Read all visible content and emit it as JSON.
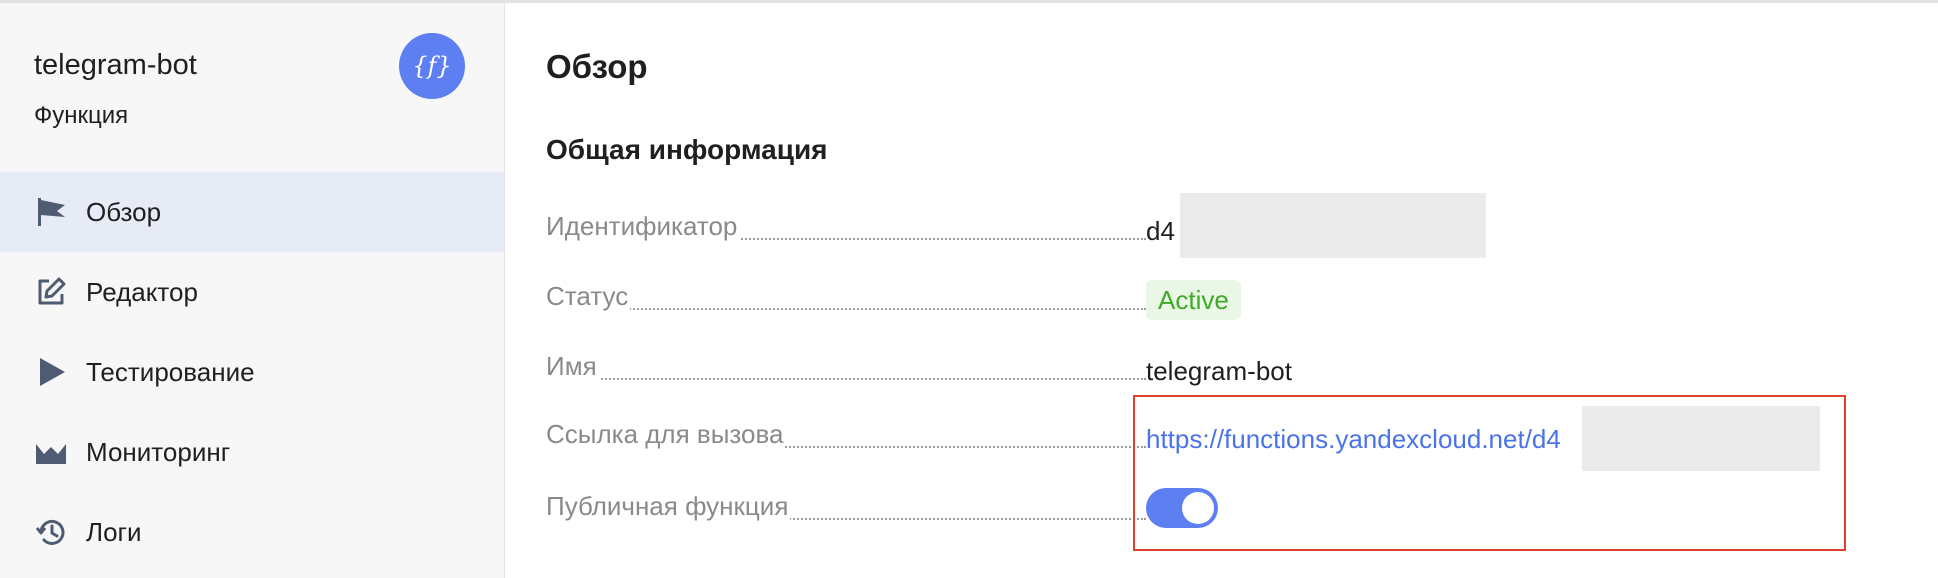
{
  "sidebar": {
    "title": "telegram-bot",
    "subtitle": "Функция",
    "badge_icon": "function-icon",
    "items": [
      {
        "label": "Обзор",
        "icon": "flag-icon",
        "active": true
      },
      {
        "label": "Редактор",
        "icon": "edit-icon",
        "active": false
      },
      {
        "label": "Тестирование",
        "icon": "play-icon",
        "active": false
      },
      {
        "label": "Мониторинг",
        "icon": "chart-icon",
        "active": false
      },
      {
        "label": "Логи",
        "icon": "history-icon",
        "active": false
      }
    ]
  },
  "main": {
    "title": "Обзор",
    "section_title": "Общая информация",
    "fields": {
      "id": {
        "label": "Идентификатор",
        "value": "d4"
      },
      "status": {
        "label": "Статус",
        "value": "Active"
      },
      "name": {
        "label": "Имя",
        "value": "telegram-bot"
      },
      "invoke_link": {
        "label": "Ссылка для вызова",
        "value": "https://functions.yandexcloud.net/d4"
      },
      "public": {
        "label": "Публичная функция",
        "value": true
      }
    }
  },
  "colors": {
    "accent": "#5d7ff2",
    "link": "#4a73e8",
    "status_green": "#3faa26",
    "highlight_red": "#e0402a"
  }
}
